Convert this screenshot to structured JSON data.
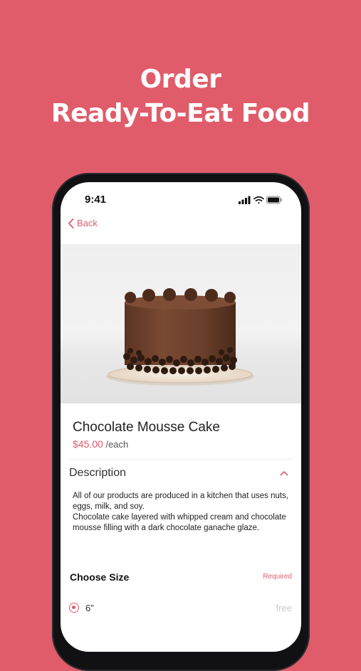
{
  "headline": {
    "line1": "Order",
    "line2": "Ready-To-Eat Food"
  },
  "status_bar": {
    "time": "9:41",
    "icons": [
      "signal-icon",
      "wifi-icon",
      "battery-icon"
    ]
  },
  "nav": {
    "back_label": "Back",
    "back_icon": "chevron-left-icon"
  },
  "product": {
    "image": "chocolate-cake-photo",
    "name": "Chocolate Mousse Cake",
    "price": "$45.00",
    "unit": "/each"
  },
  "description": {
    "heading": "Description",
    "toggle_icon": "chevron-up-icon",
    "paragraphs": [
      "All of our products are produced in a kitchen that uses nuts, eggs, milk, and soy.",
      "Chocolate cake layered with whipped cream and chocolate mousse filling with a dark chocolate ganache glaze."
    ]
  },
  "size_selector": {
    "heading": "Choose Size",
    "required_label": "Required",
    "options": [
      {
        "label": "6\"",
        "price": "free",
        "selected": true
      }
    ]
  },
  "colors": {
    "brand": "#e05c6a",
    "text": "#222222",
    "muted": "#c8c8c8"
  }
}
